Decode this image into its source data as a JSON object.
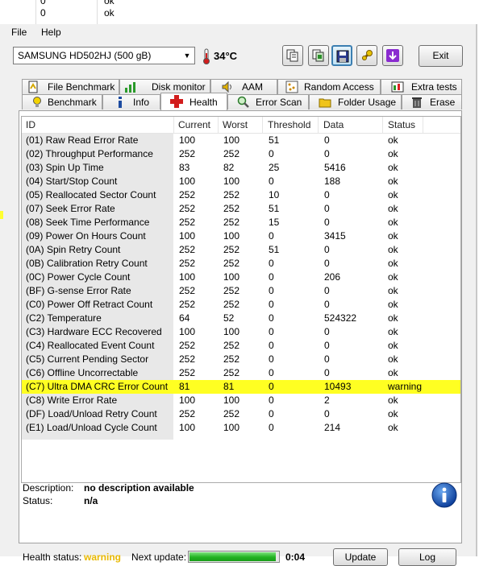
{
  "background_window": {
    "lines": [
      [
        "0",
        "ok"
      ],
      [
        "0",
        "ok"
      ]
    ]
  },
  "menu": {
    "file": "File",
    "help": "Help"
  },
  "toolbar": {
    "drive": "SAMSUNG HD502HJ (500 gB)",
    "temperature": "34°C",
    "exit_label": "Exit"
  },
  "tabs": {
    "row1": [
      "File Benchmark",
      "Disk monitor",
      "AAM",
      "Random Access",
      "Extra tests"
    ],
    "row2": [
      "Benchmark",
      "Info",
      "Health",
      "Error Scan",
      "Folder Usage",
      "Erase"
    ],
    "selected": "Health"
  },
  "table": {
    "headers": [
      "ID",
      "Current",
      "Worst",
      "Threshold",
      "Data",
      "Status"
    ],
    "rows": [
      [
        "(01) Raw Read Error Rate",
        "100",
        "100",
        "51",
        "0",
        "ok"
      ],
      [
        "(02) Throughput Performance",
        "252",
        "252",
        "0",
        "0",
        "ok"
      ],
      [
        "(03) Spin Up Time",
        "83",
        "82",
        "25",
        "5416",
        "ok"
      ],
      [
        "(04) Start/Stop Count",
        "100",
        "100",
        "0",
        "188",
        "ok"
      ],
      [
        "(05) Reallocated Sector Count",
        "252",
        "252",
        "10",
        "0",
        "ok"
      ],
      [
        "(07) Seek Error Rate",
        "252",
        "252",
        "51",
        "0",
        "ok"
      ],
      [
        "(08) Seek Time Performance",
        "252",
        "252",
        "15",
        "0",
        "ok"
      ],
      [
        "(09) Power On Hours Count",
        "100",
        "100",
        "0",
        "3415",
        "ok"
      ],
      [
        "(0A) Spin Retry Count",
        "252",
        "252",
        "51",
        "0",
        "ok"
      ],
      [
        "(0B) Calibration Retry Count",
        "252",
        "252",
        "0",
        "0",
        "ok"
      ],
      [
        "(0C) Power Cycle Count",
        "100",
        "100",
        "0",
        "206",
        "ok"
      ],
      [
        "(BF) G-sense Error Rate",
        "252",
        "252",
        "0",
        "0",
        "ok"
      ],
      [
        "(C0) Power Off Retract Count",
        "252",
        "252",
        "0",
        "0",
        "ok"
      ],
      [
        "(C2) Temperature",
        "64",
        "52",
        "0",
        "524322",
        "ok"
      ],
      [
        "(C3) Hardware ECC Recovered",
        "100",
        "100",
        "0",
        "0",
        "ok"
      ],
      [
        "(C4) Reallocated Event Count",
        "252",
        "252",
        "0",
        "0",
        "ok"
      ],
      [
        "(C5) Current Pending Sector",
        "252",
        "252",
        "0",
        "0",
        "ok"
      ],
      [
        "(C6) Offline Uncorrectable",
        "252",
        "252",
        "0",
        "0",
        "ok"
      ],
      [
        "(C7) Ultra DMA CRC Error Count",
        "81",
        "81",
        "0",
        "10493",
        "warning"
      ],
      [
        "(C8) Write Error Rate",
        "100",
        "100",
        "0",
        "2",
        "ok"
      ],
      [
        "(DF) Load/Unload Retry Count",
        "252",
        "252",
        "0",
        "0",
        "ok"
      ],
      [
        "(E1) Load/Unload Cycle Count",
        "100",
        "100",
        "0",
        "214",
        "ok"
      ]
    ],
    "highlight_color": "#ffff22"
  },
  "description": {
    "desc_label": "Description:",
    "desc_value": "no description available",
    "status_label": "Status:",
    "status_value": "n/a"
  },
  "footer": {
    "health_label": "Health status:",
    "health_value": "warning",
    "health_color": "#e8b800",
    "next_label": "Next update:",
    "progress_fraction": 0.97,
    "countdown": "0:04",
    "update_label": "Update",
    "log_label": "Log"
  }
}
